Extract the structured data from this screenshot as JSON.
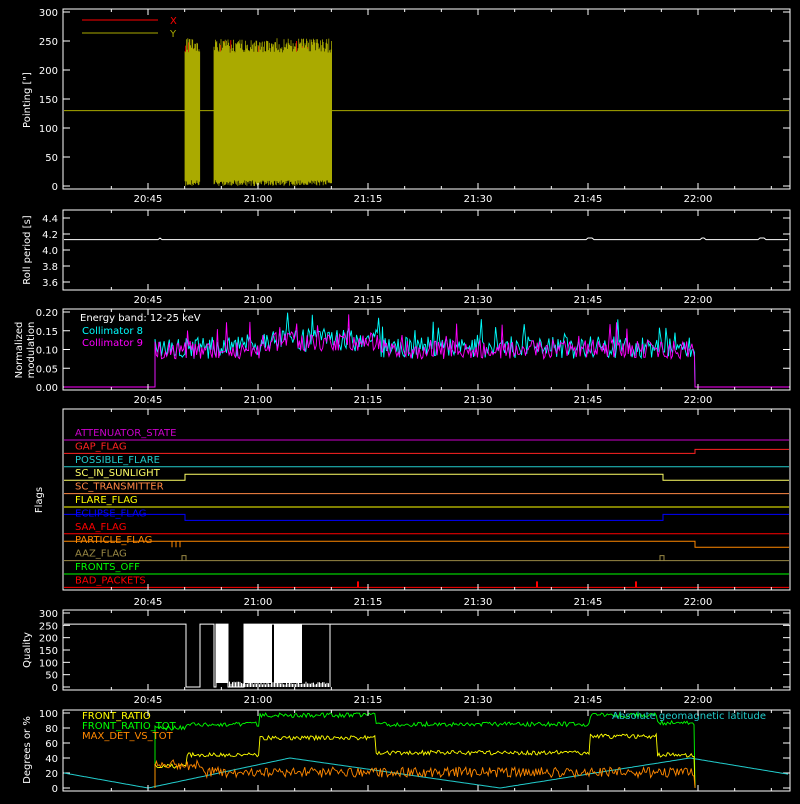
{
  "colors": {
    "bg": "#000000",
    "axis": "#ffffff",
    "red": "#ff0000",
    "olive": "#aaaa00",
    "cyan": "#00ffff",
    "magenta": "#ff00ff",
    "green": "#00ff00",
    "yellow": "#ffff00",
    "orange": "#ff8800",
    "blue": "#0000ff",
    "purple": "#cc00cc",
    "tan": "#998844",
    "sky": "#22cccc"
  },
  "time_axis": {
    "ticks": [
      "20:45",
      "21:00",
      "21:15",
      "21:30",
      "21:45",
      "22:00"
    ]
  },
  "panels": {
    "pointing": {
      "ylabel": "Pointing [\"]",
      "yticks": [
        "0",
        "50",
        "100",
        "150",
        "200",
        "250",
        "300"
      ],
      "legend": [
        {
          "name": "X",
          "color": "#ff0000"
        },
        {
          "name": "Y",
          "color": "#aaaa00"
        }
      ]
    },
    "roll": {
      "ylabel": "Roll period [s]",
      "yticks": [
        "3.6",
        "3.8",
        "4.0",
        "4.2",
        "4.4"
      ]
    },
    "modulation": {
      "ylabel1": "Normalized",
      "ylabel2": "modulation",
      "yticks": [
        "0.00",
        "0.05",
        "0.10",
        "0.15",
        "0.20"
      ],
      "legend_title": "Energy band: 12-25 keV",
      "legend": [
        {
          "name": "Collimator 8",
          "color": "#00ffff"
        },
        {
          "name": "Collimator 9",
          "color": "#ff00ff"
        }
      ]
    },
    "flags": {
      "ylabel": "Flags",
      "items": [
        {
          "name": "ATTENUATOR_STATE",
          "color": "#cc00cc"
        },
        {
          "name": "GAP_FLAG",
          "color": "#ff2222"
        },
        {
          "name": "POSSIBLE_FLARE",
          "color": "#22cccc"
        },
        {
          "name": "SC_IN_SUNLIGHT",
          "color": "#ffff66"
        },
        {
          "name": "SC_TRANSMITTER",
          "color": "#ff8844"
        },
        {
          "name": "FLARE_FLAG",
          "color": "#ffff00"
        },
        {
          "name": "ECLIPSE_FLAG",
          "color": "#0000ff"
        },
        {
          "name": "SAA_FLAG",
          "color": "#ff0000"
        },
        {
          "name": "PARTICLE_FLAG",
          "color": "#ff8800"
        },
        {
          "name": "AAZ_FLAG",
          "color": "#998844"
        },
        {
          "name": "FRONTS_OFF",
          "color": "#00ff00"
        },
        {
          "name": "BAD_PACKETS",
          "color": "#ff0000"
        }
      ]
    },
    "quality": {
      "ylabel": "Quality",
      "yticks": [
        "0",
        "50",
        "100",
        "150",
        "200",
        "250",
        "300"
      ]
    },
    "ratio": {
      "ylabel": "Degrees or %",
      "yticks": [
        "0",
        "20",
        "40",
        "60",
        "80",
        "100"
      ],
      "legend": [
        {
          "name": "FRONT_RATIO",
          "color": "#ffff00"
        },
        {
          "name": "FRONT_RATIO_TOT",
          "color": "#00ff00"
        },
        {
          "name": "MAX_DET_VS_TOT",
          "color": "#ff8800"
        }
      ],
      "legend_right": {
        "name": "Absolute geomagnetic latitude",
        "color": "#22cccc"
      }
    }
  },
  "chart_data": [
    {
      "type": "line",
      "title": "",
      "ylabel": "Pointing [\"]",
      "xlabel": "",
      "x_range": [
        "20:36",
        "22:24"
      ],
      "ylim": [
        0,
        300
      ],
      "series": [
        {
          "name": "X",
          "note_values": "dense oscillation 20:50-21:12",
          "low": 20,
          "high": 250
        },
        {
          "name": "Y",
          "constant_outside": 130,
          "low": 0,
          "high": 250
        }
      ]
    },
    {
      "type": "line",
      "ylabel": "Roll period [s]",
      "ylim": [
        3.5,
        4.5
      ],
      "series": [
        {
          "name": "",
          "values_const": 4.13
        }
      ]
    },
    {
      "type": "line",
      "ylabel": "Normalized modulation",
      "ylim": [
        0,
        0.2
      ],
      "x_range_data": [
        "20:45",
        "22:00"
      ],
      "series": [
        {
          "name": "Collimator 8",
          "mean": 0.105,
          "spread": 0.09
        },
        {
          "name": "Collimator 9",
          "mean": 0.1,
          "spread": 0.08
        }
      ]
    },
    {
      "type": "line",
      "ylabel": "Quality",
      "ylim": [
        0,
        300
      ],
      "series": [
        {
          "name": "",
          "high": 255,
          "low": 0
        }
      ]
    },
    {
      "type": "line",
      "ylabel": "Degrees or %",
      "ylim": [
        0,
        100
      ],
      "series": [
        {
          "name": "FRONT_RATIO"
        },
        {
          "name": "FRONT_RATIO_TOT"
        },
        {
          "name": "MAX_DET_VS_TOT"
        },
        {
          "name": "Absolute geomagnetic latitude"
        }
      ]
    }
  ]
}
